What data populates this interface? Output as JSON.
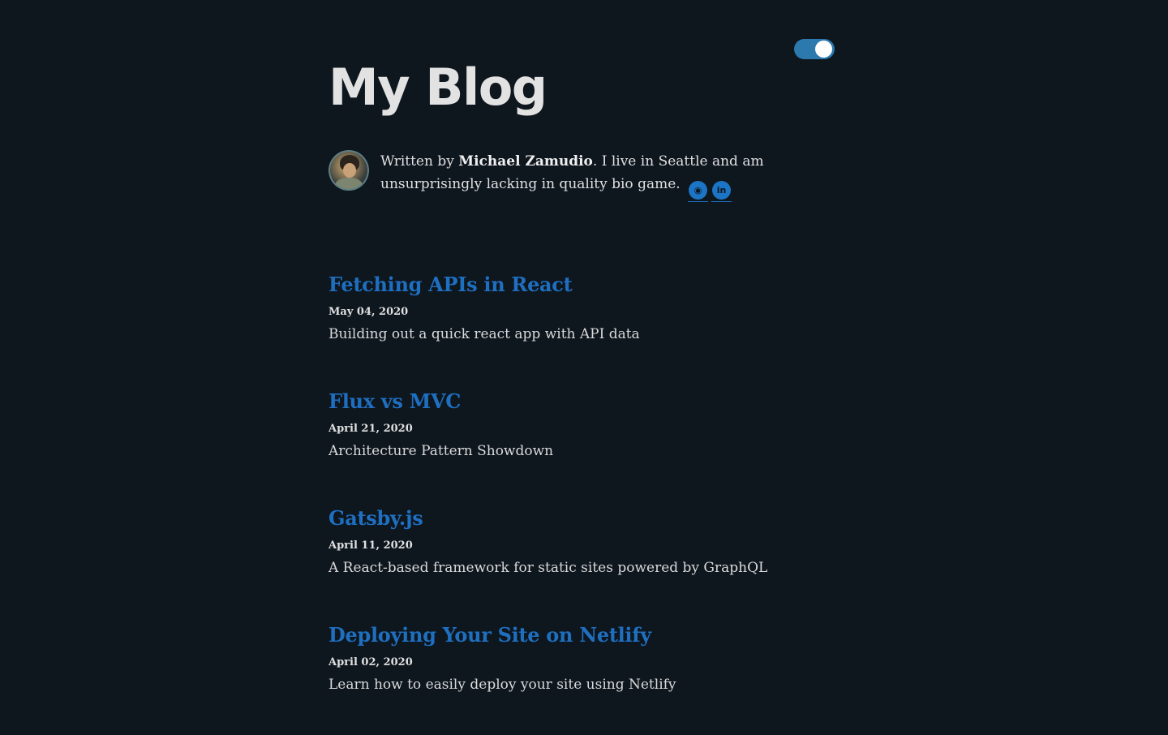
{
  "header": {
    "title": "My Blog",
    "theme_toggle": {
      "state": "on",
      "color": "#2b79ad"
    }
  },
  "bio": {
    "prefix": "Written by ",
    "author": "Michael Zamudio",
    "suffix": ". I live in Seattle and am unsurprisingly lacking in quality bio game.",
    "social": [
      {
        "name": "GitHub",
        "icon": "github-icon",
        "glyph": "◉"
      },
      {
        "name": "LinkedIn",
        "icon": "linkedin-icon",
        "glyph": "in"
      }
    ]
  },
  "posts": [
    {
      "title": "Fetching APIs in React",
      "date": "May 04, 2020",
      "description": "Building out a quick react app with API data"
    },
    {
      "title": "Flux vs MVC",
      "date": "April 21, 2020",
      "description": "Architecture Pattern Showdown"
    },
    {
      "title": "Gatsby.js",
      "date": "April 11, 2020",
      "description": "A React-based framework for static sites powered by GraphQL"
    },
    {
      "title": "Deploying Your Site on Netlify",
      "date": "April 02, 2020",
      "description": "Learn how to easily deploy your site using Netlify"
    }
  ],
  "colors": {
    "background": "#0e161e",
    "link": "#1f6fc0",
    "text": "#dcdcdc",
    "toggle": "#2b79ad"
  }
}
